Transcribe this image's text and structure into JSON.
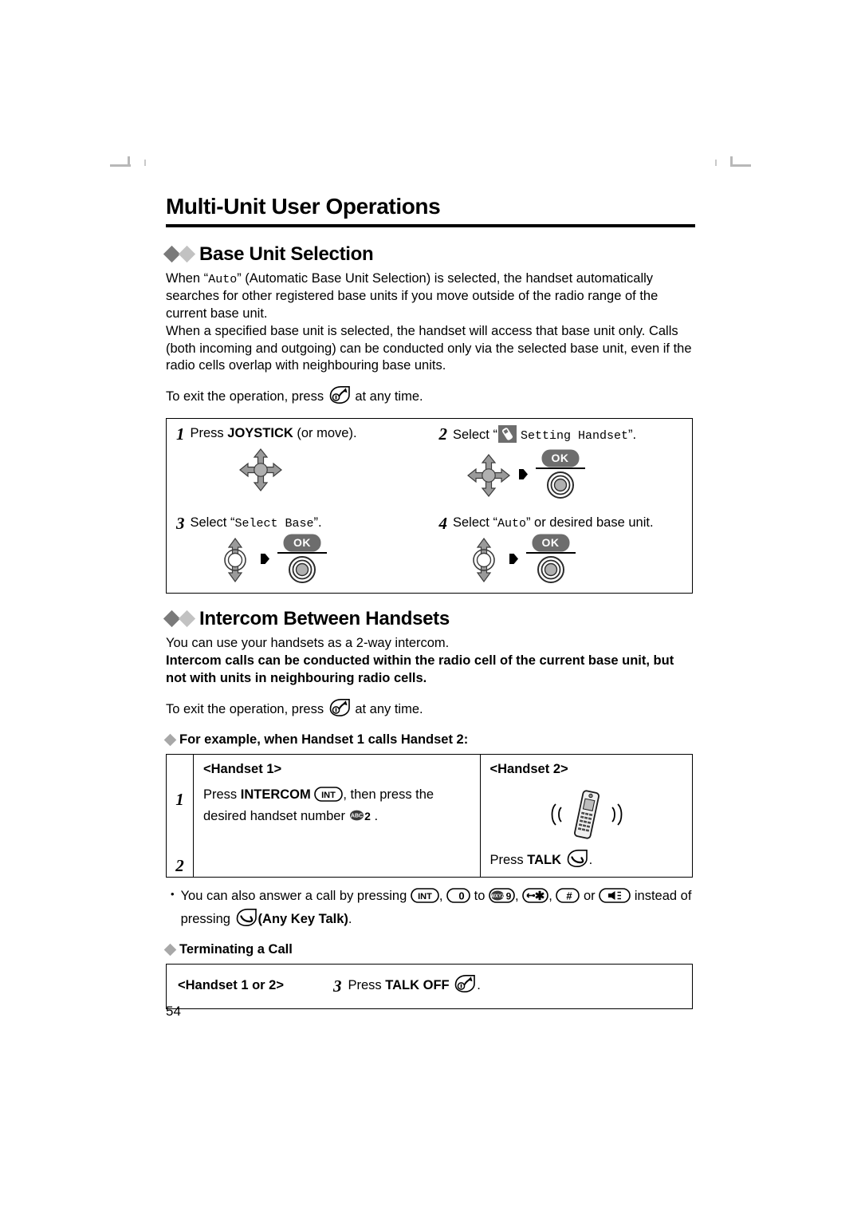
{
  "document": {
    "chapter_title": "Multi-Unit User Operations",
    "page_number": "54"
  },
  "base_unit_selection": {
    "heading": "Base Unit Selection",
    "paragraph_1_pre": "When “",
    "paragraph_1_mono": "Auto",
    "paragraph_1_post": "” (Automatic Base Unit Selection) is selected, the handset automatically searches for other registered base units if you move outside of the radio range of the current base unit.",
    "paragraph_2": "When a specified base unit is selected, the handset will access that base unit only. Calls (both incoming and outgoing) can be conducted only via the selected base unit, even if the radio cells overlap with neighbouring base units.",
    "exit_pre": "To exit the operation, press",
    "exit_post": "at any time.",
    "steps": [
      {
        "number": "1",
        "text_pre": "Press ",
        "text_bold": "JOYSTICK",
        "text_post": " (or move).",
        "icons": [
          "joystick-4way-icon"
        ]
      },
      {
        "number": "2",
        "text_pre": "Select “",
        "menu_icon": "setting-handset-icon",
        "text_mono": "Setting Handset",
        "text_post": "”.",
        "icons": [
          "joystick-4way-icon",
          "arrow-right-icon",
          "ok-button-icon"
        ]
      },
      {
        "number": "3",
        "text_pre": "Select “",
        "text_mono": "Select Base",
        "text_post": "”.",
        "icons": [
          "joystick-updown-icon",
          "arrow-right-icon",
          "ok-button-icon"
        ]
      },
      {
        "number": "4",
        "text_pre": "Select “",
        "text_mono": "Auto",
        "text_post": "” or desired base unit.",
        "icons": [
          "joystick-updown-icon",
          "arrow-right-icon",
          "ok-button-icon"
        ]
      }
    ],
    "ok_label": "OK"
  },
  "intercom": {
    "heading": "Intercom Between Handsets",
    "paragraph_1": "You can use your handsets as a 2-way intercom.",
    "paragraph_bold": "Intercom calls can be conducted within the radio cell of the current base unit, but not with units in neighbouring radio cells.",
    "exit_pre": "To exit the operation, press",
    "exit_post": "at any time.",
    "example_heading": "For example, when Handset 1 calls Handset 2:",
    "table": {
      "col_a_header": "<Handset 1>",
      "col_b_header": "<Handset 2>",
      "rows": [
        {
          "number": "1",
          "col_a_pre": "Press ",
          "col_a_bold": "INTERCOM",
          "col_a_key_1": "INT",
          "col_a_mid": ", then press the desired handset number ",
          "col_a_key_2_abc": "ABC",
          "col_a_key_2_digit": "2",
          "col_a_post": ".",
          "col_b_icon": "ringing-handset-icon"
        },
        {
          "number": "2",
          "col_a_text": "",
          "col_b_pre": "Press ",
          "col_b_bold": "TALK",
          "col_b_icon": "talk-key-icon",
          "col_b_post": "."
        }
      ]
    },
    "note": {
      "bullet": "•",
      "pre": "You can also answer a call by pressing",
      "keys": [
        "INT",
        "0",
        "WXYZ9",
        "✱",
        "#",
        "speaker"
      ],
      "key_labels": {
        "int": "INT",
        "zero": "0",
        "to": "to",
        "nine_prefix": "WXYZ",
        "nine": "9",
        "star": "✱",
        "hash": "#"
      },
      "mid": "instead of pressing",
      "any_key_talk": "(Any Key Talk)",
      "post": "."
    },
    "terminating": {
      "heading": "Terminating a Call",
      "label": "<Handset 1 or 2>",
      "step_number": "3",
      "step_pre": "Press ",
      "step_bold": "TALK OFF",
      "step_post": "."
    }
  },
  "colors": {
    "joystick_gray": "#9a9a9a",
    "ok_pill_gray": "#6d6d6d",
    "diamond_dark": "#7a7a7a",
    "diamond_light": "#c2c2c2",
    "menu_icon_gray": "#6d6d6d"
  }
}
